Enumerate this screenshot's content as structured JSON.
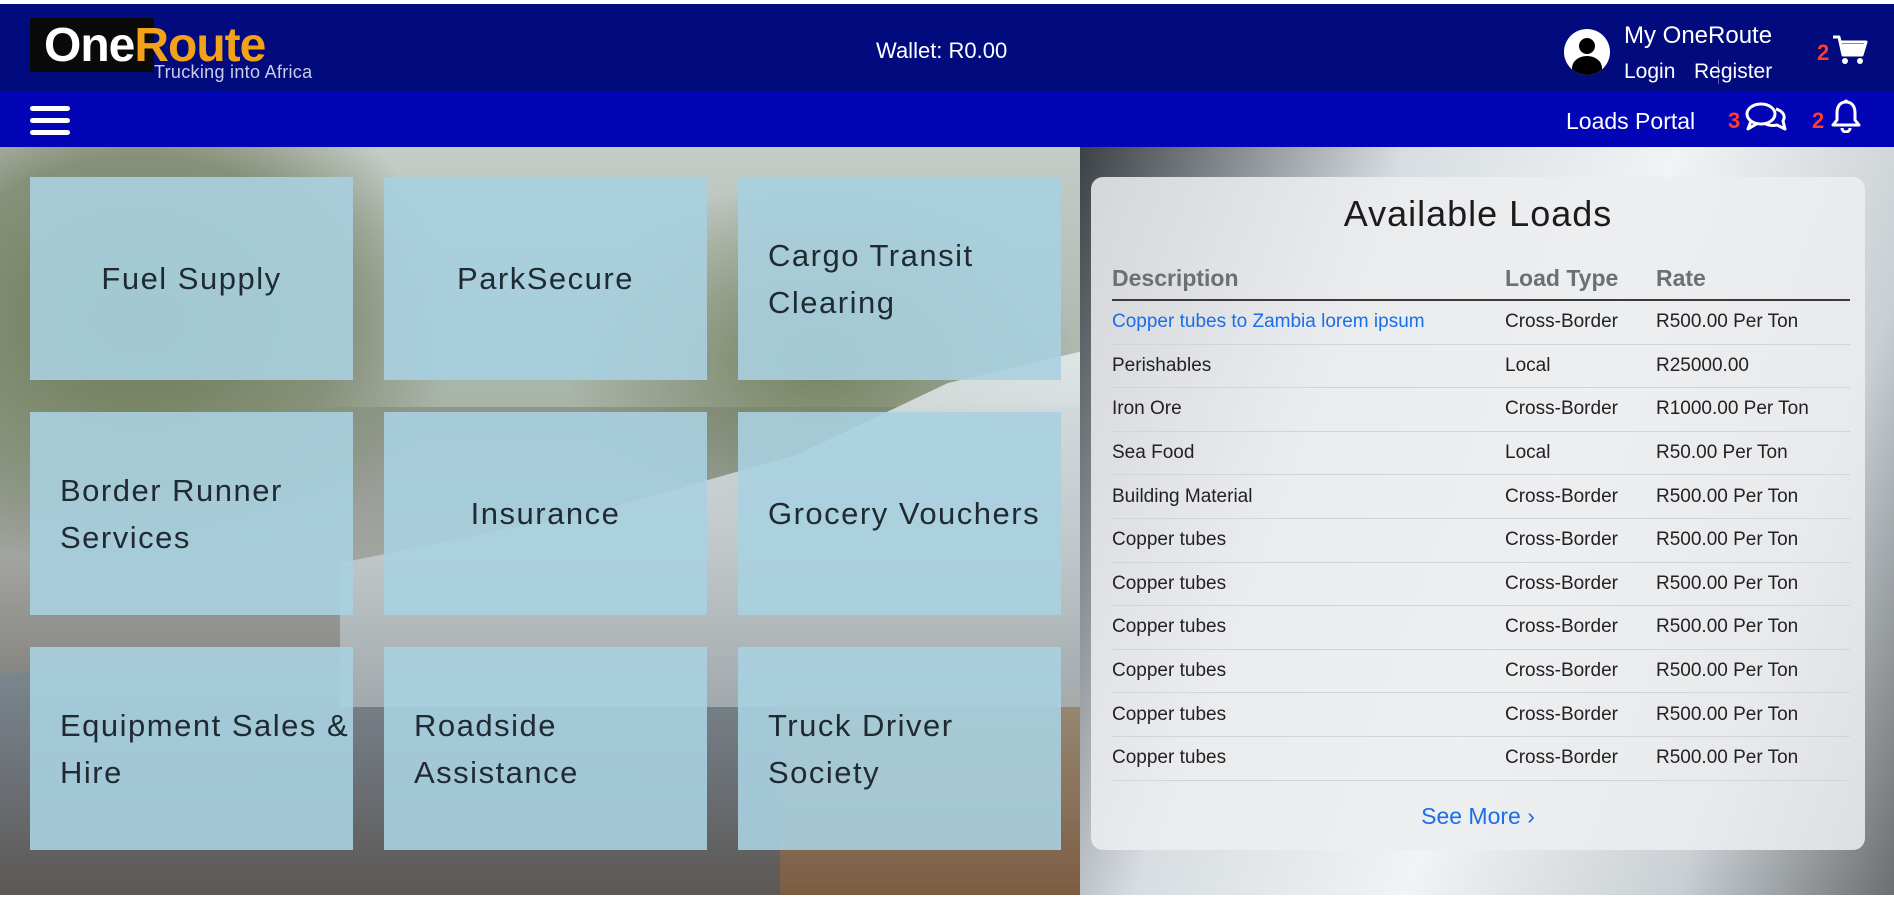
{
  "header": {
    "logo_one": "One",
    "logo_route": "Route",
    "logo_tagline": "Trucking into Africa",
    "wallet": "Wallet: R0.00",
    "account_title": "My OneRoute",
    "login_label": "Login",
    "register_label": "Register",
    "cart_count": "2"
  },
  "nav": {
    "loads_portal_label": "Loads Portal",
    "messages_count": "3",
    "notifications_count": "2"
  },
  "tiles": [
    {
      "label": "Fuel Supply"
    },
    {
      "label": "ParkSecure"
    },
    {
      "label": "Cargo Transit Clearing"
    },
    {
      "label": "Border Runner Services"
    },
    {
      "label": "Insurance"
    },
    {
      "label": "Grocery Vouchers"
    },
    {
      "label": "Equipment Sales & Hire"
    },
    {
      "label": "Roadside Assistance"
    },
    {
      "label": "Truck Driver Society"
    }
  ],
  "loads": {
    "title": "Available Loads",
    "columns": [
      "Description",
      "Load Type",
      "Rate"
    ],
    "rows": [
      {
        "description": "Copper tubes to Zambia lorem ipsum",
        "type": "Cross-Border",
        "rate": "R500.00 Per Ton"
      },
      {
        "description": "Perishables",
        "type": "Local",
        "rate": "R25000.00"
      },
      {
        "description": "Iron Ore",
        "type": "Cross-Border",
        "rate": "R1000.00 Per Ton"
      },
      {
        "description": "Sea Food",
        "type": "Local",
        "rate": "R50.00 Per Ton"
      },
      {
        "description": "Building Material",
        "type": "Cross-Border",
        "rate": "R500.00 Per Ton"
      },
      {
        "description": "Copper tubes",
        "type": "Cross-Border",
        "rate": "R500.00 Per Ton"
      },
      {
        "description": "Copper tubes",
        "type": "Cross-Border",
        "rate": "R500.00 Per Ton"
      },
      {
        "description": "Copper tubes",
        "type": "Cross-Border",
        "rate": "R500.00 Per Ton"
      },
      {
        "description": "Copper tubes",
        "type": "Cross-Border",
        "rate": "R500.00 Per Ton"
      },
      {
        "description": "Copper tubes",
        "type": "Cross-Border",
        "rate": "R500.00 Per Ton"
      },
      {
        "description": "Copper tubes",
        "type": "Cross-Border",
        "rate": "R500.00 Per Ton"
      }
    ],
    "see_more_label": "See More ›"
  },
  "colors": {
    "header_bg": "#010b7e",
    "nav_bg": "#0205b5",
    "logo_accent": "#f2a118",
    "badge": "#ff3b30",
    "link": "#1a6ee8",
    "tile_bg": "#a8d0e0"
  },
  "icons": [
    "user-avatar-icon",
    "cart-icon",
    "menu-icon",
    "chat-icon",
    "bell-icon"
  ]
}
